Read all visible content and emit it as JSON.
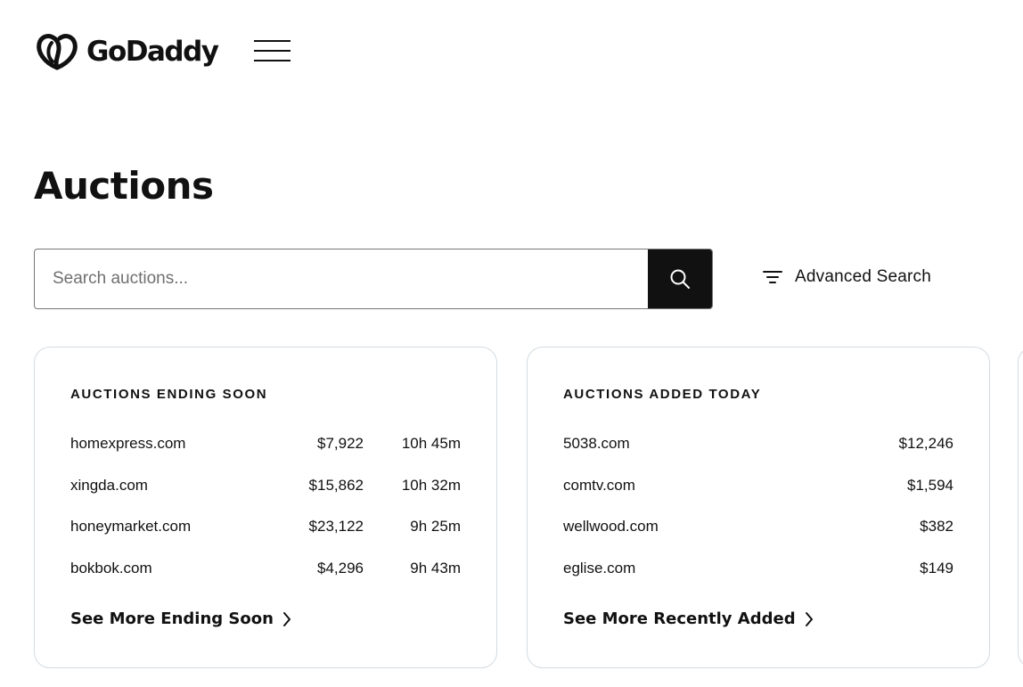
{
  "brand": {
    "name": "GoDaddy",
    "logo_icon": "godaddy-heart-logo"
  },
  "header": {
    "menu_icon": "hamburger-menu-icon"
  },
  "page": {
    "title": "Auctions"
  },
  "search": {
    "placeholder": "Search auctions...",
    "value": "",
    "button_icon": "search-icon",
    "advanced_label": "Advanced Search",
    "advanced_icon": "filter-icon"
  },
  "ending_soon": {
    "heading": "AUCTIONS ENDING SOON",
    "rows": [
      {
        "domain": "homexpress.com",
        "price": "$7,922",
        "time": "10h 45m"
      },
      {
        "domain": "xingda.com",
        "price": "$15,862",
        "time": "10h 32m"
      },
      {
        "domain": "honeymarket.com",
        "price": "$23,122",
        "time": "9h 25m"
      },
      {
        "domain": "bokbok.com",
        "price": "$4,296",
        "time": "9h 43m"
      }
    ],
    "see_more": "See More Ending Soon"
  },
  "added_today": {
    "heading": "AUCTIONS ADDED TODAY",
    "rows": [
      {
        "domain": "5038.com",
        "price": "$12,246"
      },
      {
        "domain": "comtv.com",
        "price": "$1,594"
      },
      {
        "domain": "wellwood.com",
        "price": "$382"
      },
      {
        "domain": "eglise.com",
        "price": "$149"
      }
    ],
    "see_more": "See More Recently Added"
  },
  "colors": {
    "text": "#111111",
    "search_button": "#111111",
    "card_border": "#d4dbe0",
    "input_border": "#767676"
  }
}
